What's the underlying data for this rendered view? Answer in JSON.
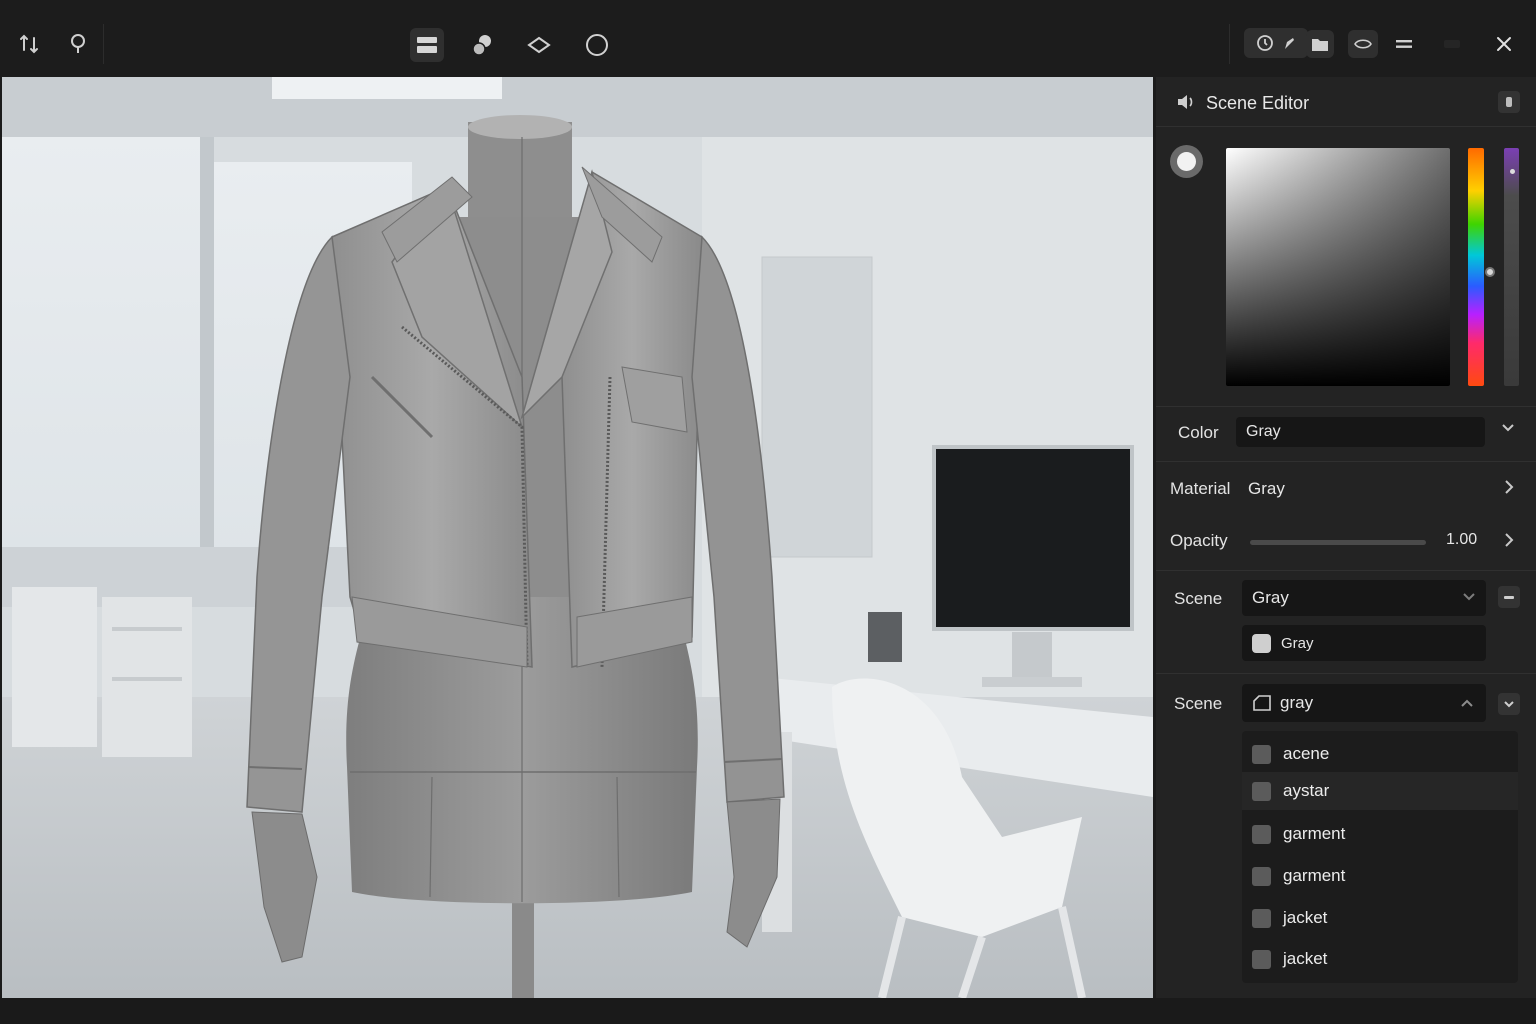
{
  "toolbar": {
    "left_icons": [
      "move-icon",
      "lasso-icon"
    ],
    "center_icons": [
      "layers-icon",
      "spheres-icon",
      "plane-icon",
      "circle-icon"
    ],
    "right_icons": [
      "clock-icon",
      "brush-icon",
      "folder-icon",
      "eye-icon",
      "menu-icon",
      "minimize-icon",
      "close-icon"
    ]
  },
  "panel": {
    "title": "Scene Editor",
    "header_icon": "speaker-icon",
    "color_picker": {
      "hue": "gray",
      "alpha": 1.0
    },
    "color": {
      "label": "Color",
      "value": "Gray"
    },
    "material": {
      "label": "Material",
      "value": "Gray"
    },
    "opacity": {
      "label": "Opacity",
      "value": "1.00",
      "fraction": 1.0
    },
    "scene1": {
      "label": "Scene",
      "value": "Gray",
      "swatch_label": "Gray"
    },
    "scene2": {
      "label": "Scene",
      "value": "gray",
      "items": [
        "acene",
        "aystar",
        "garment",
        "garment",
        "jacket",
        "jacket"
      ],
      "selected_index": 1
    }
  },
  "colors": {
    "panel_bg": "#232323",
    "field_bg": "#161616",
    "toolbar_bg": "#1c1c1c"
  }
}
